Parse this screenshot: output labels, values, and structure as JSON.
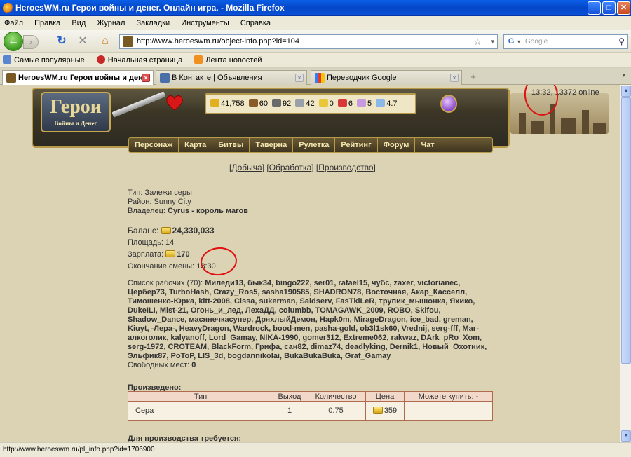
{
  "window": {
    "title": "HeroesWM.ru Герои войны и денег. Онлайн игра. - Mozilla Firefox",
    "btn_min": "_",
    "btn_max": "□",
    "btn_close": "✕"
  },
  "menubar": [
    "Файл",
    "Правка",
    "Вид",
    "Журнал",
    "Закладки",
    "Инструменты",
    "Справка"
  ],
  "navbar": {
    "url": "http://www.heroeswm.ru/object-info.php?id=104",
    "search_placeholder": "Google",
    "back_glyph": "←",
    "forward_glyph": "›",
    "reload_glyph": "↻",
    "stop_glyph": "✕",
    "home_glyph": "⌂",
    "star_glyph": "☆",
    "drop_glyph": "▾",
    "google_glyph": "G",
    "mag_glyph": "⚲"
  },
  "bookmarks": [
    "Самые популярные",
    "Начальная страница",
    "Лента новостей"
  ],
  "tabs": [
    {
      "label": "HeroesWM.ru Герои войны и ден...",
      "active": true
    },
    {
      "label": "В Контакте | Объявления",
      "active": false
    },
    {
      "label": "Переводчик Google",
      "active": false
    }
  ],
  "tab_close_glyph": "×",
  "tab_new_glyph": "+",
  "tab_list_glyph": "▾",
  "game": {
    "logo": "Герои",
    "logo_sub": "Войны и Денег",
    "clock": "13:32, 13372 online",
    "resources": [
      {
        "value": "41,758",
        "icon": "gold-icon",
        "color": "#e0b020"
      },
      {
        "value": "60",
        "icon": "wood-icon",
        "color": "#8a5a28"
      },
      {
        "value": "92",
        "icon": "ore-icon",
        "color": "#6a6a6a"
      },
      {
        "value": "42",
        "icon": "mercury-icon",
        "color": "#9aa0a8"
      },
      {
        "value": "0",
        "icon": "sulfur-icon",
        "color": "#e8c838"
      },
      {
        "value": "6",
        "icon": "crystal-icon",
        "color": "#d83838"
      },
      {
        "value": "5",
        "icon": "gems-icon",
        "color": "#c898e0"
      },
      {
        "value": "4.7",
        "icon": "diamond-icon",
        "color": "#8ab8e8"
      }
    ],
    "nav": [
      "Персонаж",
      "Карта",
      "Битвы",
      "Таверна",
      "Рулетка",
      "Рейтинг",
      "Форум",
      "Чат"
    ]
  },
  "page": {
    "links_open": "[",
    "links": [
      "Добыча",
      "Обработка",
      "Производство"
    ],
    "links_sep": "] [",
    "links_close": "]",
    "type_label": "Тип:",
    "type_value": "Залежи серы",
    "region_label": "Район:",
    "region_value": "Sunny City",
    "owner_label": "Владелец:",
    "owner_value": "Cyrus - король магов",
    "balance_label": "Баланс:",
    "balance_value": "24,330,033",
    "area_label": "Площадь:",
    "area_value": "14",
    "salary_label": "Зарплата:",
    "salary_value": "170",
    "shift_label": "Окончание смены:",
    "shift_value": "13:30",
    "workers_label": "Список рабочих (70):",
    "workers": "Миледи13, бык34, bingo222, ser01, rafael15, чубс, zaxer, victorianec, Цербер73, TurboHash, Crazy_Ros5, sasha190585, SHADRON78, Восточная, Акар_Касселл, Тимошенко-Юрка, kitt-2008, Cissa, sukerman, Saidserv, FasTklLeR, трупик_мышонка, Яхико, DukeILI, Mist-21, Огонь_и_лед, ЛехаДД, columbb, TOMAGAWK_2009, ROBO, Skifou, Shadow_Dance, масянечкасупер, ДряхлыйДемон, Hapk0m, MirageDragon, ice_bad, greman, Kiuyt, -Лера-, HeavyDragon, Wardrock, bood-men, pasha-gold, ob3l1sk60, Vrednij, serg-fff, Маг-алкоголик, kalyanoff, Lord_Gamay, NIKA-1990, gomer312, Extreme062, rakwaz, DArk_pRo_Xom, serg-1972, CROTEAM, BlackForm, Грифа, сан82, dimaz74, deadlyking, Dernik1, Новый_Охотник, Эльфик87, PoToP, LIS_3d, bogdannikolai, BukaBukaBuka, Graf_Gamay",
    "free_label": "Свободных мест:",
    "free_value": "0",
    "produced_label": "Произведено:",
    "table_headers": [
      "Тип",
      "Выход",
      "Количество",
      "Цена",
      "Можете купить: -"
    ],
    "table_rows": [
      {
        "type": "Сера",
        "output": "1",
        "quantity": "0.75",
        "price": "359",
        "buy": ""
      }
    ],
    "need_label": "Для производства требуется:"
  },
  "statusbar": "http://www.heroeswm.ru/pl_info.php?id=1706900"
}
